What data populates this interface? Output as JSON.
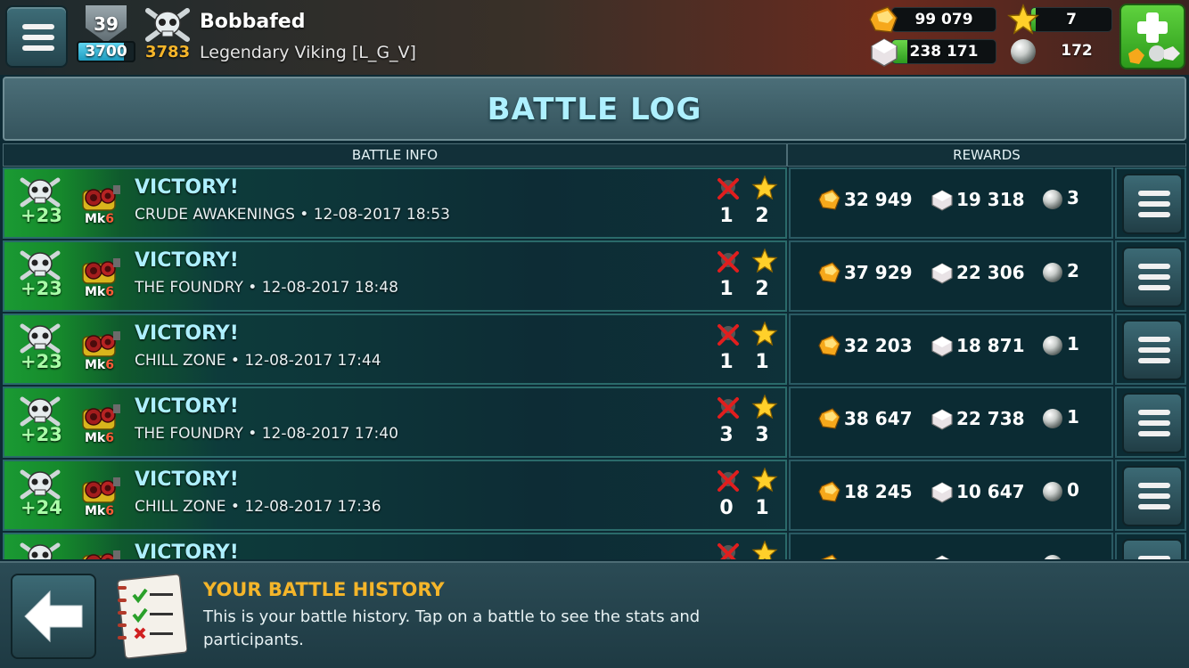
{
  "header": {
    "level": "39",
    "xp_value": "3700",
    "xp_progress": 0.82,
    "trophies": "3783",
    "player_name": "Bobbafed",
    "clan": "Legendary Viking [L_G_V]",
    "gold": "99 079",
    "silver": "238 171",
    "silver_progress": 0.15,
    "stars": "7",
    "stars_progress": 0.05,
    "pearls": "172",
    "colors": {
      "accent": "#aef0ff",
      "gold": "#f5b52a",
      "green": "#3db62c"
    },
    "icons": {
      "menu": "hamburger-icon",
      "shop": "plus-shop-icon"
    }
  },
  "title": "BATTLE LOG",
  "columns": {
    "battle_info": "BATTLE INFO",
    "rewards": "REWARDS"
  },
  "battles": [
    {
      "trophies": "+23",
      "mk_prefix": "Mk",
      "mk_level": "6",
      "result": "VICTORY!",
      "map": "CRUDE AWAKENINGS",
      "datetime": "12-08-2017 18:53",
      "kills": "1",
      "stars": "2",
      "gold": "32 949",
      "silver": "19 318",
      "pearls": "3"
    },
    {
      "trophies": "+23",
      "mk_prefix": "Mk",
      "mk_level": "6",
      "result": "VICTORY!",
      "map": "THE FOUNDRY",
      "datetime": "12-08-2017 18:48",
      "kills": "1",
      "stars": "2",
      "gold": "37 929",
      "silver": "22 306",
      "pearls": "2"
    },
    {
      "trophies": "+23",
      "mk_prefix": "Mk",
      "mk_level": "6",
      "result": "VICTORY!",
      "map": "CHILL ZONE",
      "datetime": "12-08-2017 17:44",
      "kills": "1",
      "stars": "1",
      "gold": "32 203",
      "silver": "18 871",
      "pearls": "1"
    },
    {
      "trophies": "+23",
      "mk_prefix": "Mk",
      "mk_level": "6",
      "result": "VICTORY!",
      "map": "THE FOUNDRY",
      "datetime": "12-08-2017 17:40",
      "kills": "3",
      "stars": "3",
      "gold": "38 647",
      "silver": "22 738",
      "pearls": "1"
    },
    {
      "trophies": "+24",
      "mk_prefix": "Mk",
      "mk_level": "6",
      "result": "VICTORY!",
      "map": "CHILL ZONE",
      "datetime": "12-08-2017 17:36",
      "kills": "0",
      "stars": "1",
      "gold": "18 245",
      "silver": "10 647",
      "pearls": "0"
    },
    {
      "trophies": "",
      "mk_prefix": "",
      "mk_level": "",
      "result": "VICTORY!",
      "map": "",
      "datetime": "",
      "kills": "",
      "stars": "",
      "gold": "",
      "silver": "",
      "pearls": ""
    }
  ],
  "separator": " • ",
  "footer": {
    "hint_title": "YOUR BATTLE HISTORY",
    "hint_body": "This is your battle history. Tap on a battle to see the stats and participants."
  }
}
